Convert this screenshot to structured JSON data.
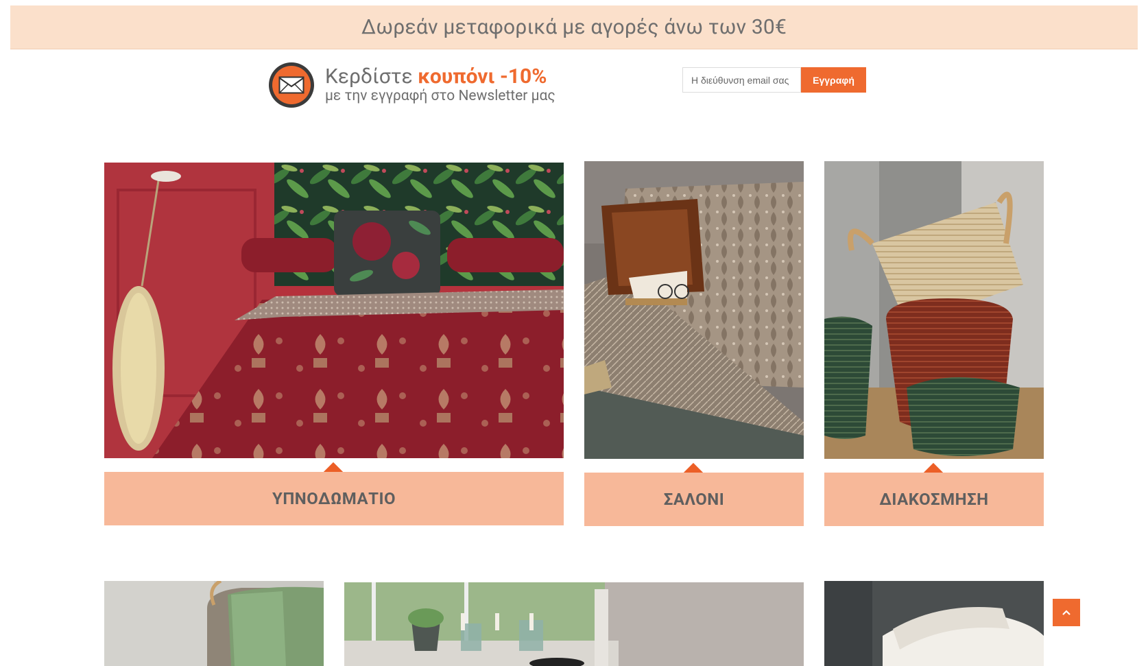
{
  "promo": {
    "text": "Δωρεάν μεταφορικά με αγορές άνω των 30€"
  },
  "newsletter": {
    "line1_prefix": "Κερδίστε ",
    "line1_highlight": "κουπόνι -10%",
    "line2": "με την εγγραφή στο Newsletter μας",
    "input_placeholder": "Η διεύθυνση email σας",
    "submit_label": "Εγγραφή",
    "icon": "envelope-icon"
  },
  "categories": [
    {
      "label": "ΥΠΝΟΔΩΜΑΤΙΟ"
    },
    {
      "label": "ΣΑΛΟΝΙ"
    },
    {
      "label": "ΔΙΑΚΟΣΜΗΣΗ"
    }
  ],
  "scroll_top": {
    "icon": "chevron-up-icon"
  },
  "colors": {
    "accent": "#ef6a2f",
    "promo_bg": "#fbe0cb",
    "label_bg": "#f7b899",
    "text_gray": "#6e6e6e"
  }
}
